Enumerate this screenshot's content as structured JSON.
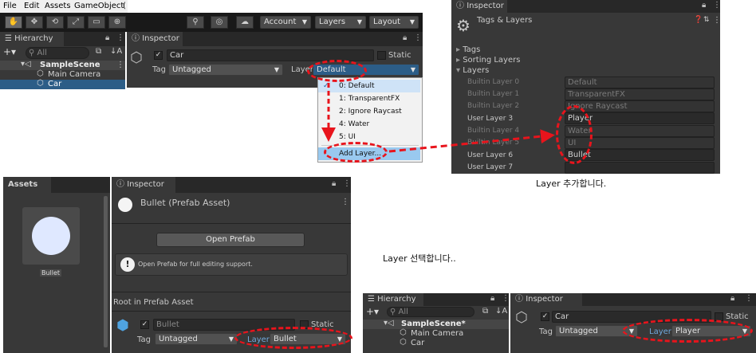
{
  "menubar": {
    "items": [
      "File",
      "Edit",
      "Assets",
      "GameObject",
      "("
    ]
  },
  "toolbar": {
    "account": "Account",
    "layers": "Layers",
    "layout": "Layout"
  },
  "hierarchy1": {
    "tab": "Hierarchy",
    "search_placeholder": "All",
    "scene": "SampleScene",
    "items": [
      "Main Camera",
      "Car"
    ]
  },
  "inspector1": {
    "tab": "Inspector",
    "object_name": "Car",
    "static_label": "Static",
    "tag_label": "Tag",
    "tag_value": "Untagged",
    "layer_label": "Layer",
    "layer_value": "Default"
  },
  "layer_menu": {
    "items": [
      "Default",
      "TransparentFX",
      "Ignore Raycast",
      "Water",
      "UI"
    ],
    "prefixes": [
      "0:",
      "1:",
      "2:",
      "4:",
      "5:"
    ],
    "add": "Add Layer..."
  },
  "tags_layers": {
    "tab": "Inspector",
    "title": "Tags & Layers",
    "sections": [
      "Tags",
      "Sorting Layers",
      "Layers"
    ],
    "rows": [
      {
        "label": "Builtin Layer 0",
        "value": "Default"
      },
      {
        "label": "Builtin Layer 1",
        "value": "TransparentFX"
      },
      {
        "label": "Builtin Layer 2",
        "value": "Ignore Raycast"
      },
      {
        "label": "User Layer 3",
        "value": "Player"
      },
      {
        "label": "Builtin Layer 4",
        "value": "Water"
      },
      {
        "label": "Builtin Layer 5",
        "value": "UI"
      },
      {
        "label": "User Layer 6",
        "value": "Bullet"
      },
      {
        "label": "User Layer 7",
        "value": ""
      }
    ]
  },
  "caption_add": "Layer 추가합니다.",
  "caption_select": "Layer 선택합니다..",
  "assets": {
    "tab": "Assets",
    "item": "Bullet"
  },
  "inspector2": {
    "tab": "Inspector",
    "title": "Bullet (Prefab Asset)",
    "open_button": "Open Prefab",
    "info": "Open Prefab for full editing support.",
    "root_label": "Root in Prefab Asset",
    "name": "Bullet",
    "static_label": "Static",
    "tag_label": "Tag",
    "tag_value": "Untagged",
    "layer_label": "Layer",
    "layer_value": "Bullet"
  },
  "hierarchy3": {
    "tab": "Hierarchy",
    "search_placeholder": "All",
    "scene": "SampleScene*",
    "items": [
      "Main Camera",
      "Car"
    ]
  },
  "inspector3": {
    "tab": "Inspector",
    "object_name": "Car",
    "static_label": "Static",
    "tag_label": "Tag",
    "tag_value": "Untagged",
    "layer_label": "Layer",
    "layer_value": "Player"
  },
  "colors": {
    "highlight": "#e8141c",
    "selection": "#2c5d87",
    "layer_blue": "#6fa8dc"
  }
}
